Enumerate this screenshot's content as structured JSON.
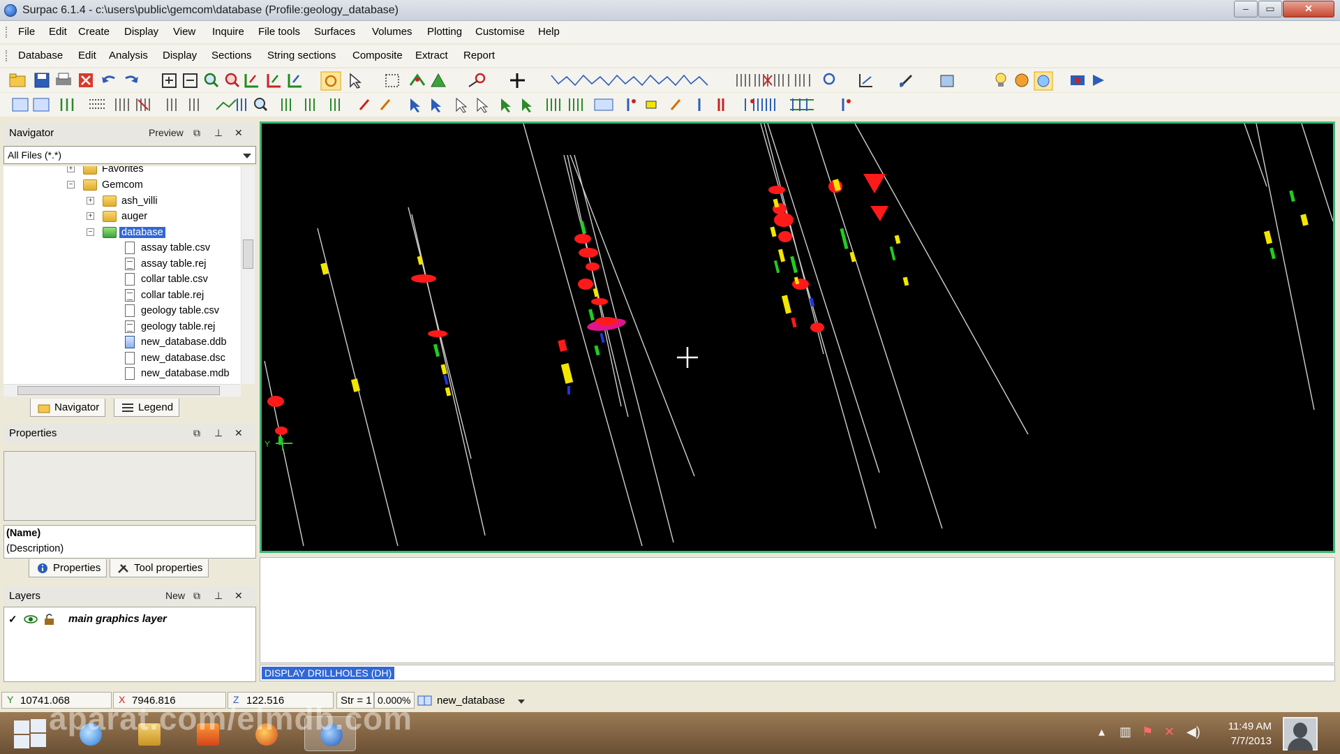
{
  "window": {
    "title": "Surpac 6.1.4 - c:\\users\\public\\gemcom\\database (Profile:geology_database)",
    "min_glyph": "–",
    "max_glyph": "▭",
    "close_glyph": "✕"
  },
  "menubar": [
    "File",
    "Edit",
    "Create",
    "Display",
    "View",
    "Inquire",
    "File tools",
    "Surfaces",
    "Volumes",
    "Plotting",
    "Customise",
    "Help"
  ],
  "menubar2": [
    "Database",
    "Edit",
    "Analysis",
    "Display",
    "Sections",
    "String sections",
    "Composite",
    "Extract",
    "Report"
  ],
  "navigator": {
    "title": "Navigator",
    "preview_label": "Preview",
    "filter": "All Files (*.*)",
    "tree": [
      {
        "label": "Favorites",
        "kind": "folder",
        "level": 1,
        "expander": "+"
      },
      {
        "label": "Gemcom",
        "kind": "folder",
        "level": 1,
        "expander": "−"
      },
      {
        "label": "ash_villi",
        "kind": "folder",
        "level": 2,
        "expander": "+"
      },
      {
        "label": "auger",
        "kind": "folder",
        "level": 2,
        "expander": "+"
      },
      {
        "label": "database",
        "kind": "folder-selected",
        "level": 2,
        "expander": "−"
      },
      {
        "label": "assay table.csv",
        "kind": "file",
        "level": 3
      },
      {
        "label": "assay table.rej",
        "kind": "file-lined",
        "level": 3
      },
      {
        "label": "collar table.csv",
        "kind": "file",
        "level": 3
      },
      {
        "label": "collar table.rej",
        "kind": "file-lined",
        "level": 3
      },
      {
        "label": "geology table.csv",
        "kind": "file",
        "level": 3
      },
      {
        "label": "geology table.rej",
        "kind": "file-lined",
        "level": 3
      },
      {
        "label": "new_database.ddb",
        "kind": "file-db",
        "level": 3
      },
      {
        "label": "new_database.dsc",
        "kind": "file",
        "level": 3
      },
      {
        "label": "new_database.mdb",
        "kind": "file",
        "level": 3
      }
    ],
    "tabs": [
      "Navigator",
      "Legend"
    ]
  },
  "properties": {
    "title": "Properties",
    "name_label": "(Name)",
    "description_label": "(Description)",
    "tabs": [
      "Properties",
      "Tool properties"
    ]
  },
  "layers": {
    "title": "Layers",
    "new_label": "New",
    "items": [
      {
        "check": "✓",
        "name": "main graphics layer"
      }
    ]
  },
  "viewport": {
    "background": "#000000",
    "frame_color": "#3cb878",
    "axis_label": "Y"
  },
  "command_line": {
    "text": "DISPLAY DRILLHOLES (DH)"
  },
  "status": {
    "y_axis": "Y",
    "y_value": "10741.068",
    "x_axis": "X",
    "x_value": "7946.816",
    "z_axis": "Z",
    "z_value": "122.516",
    "str_label": "Str = 1",
    "percent": "0.000%",
    "database": "new_database"
  },
  "taskbar": {
    "watermark": "aparat.com/elmdb.com",
    "time": "11:49 AM",
    "date": "7/7/2013"
  },
  "colors": {
    "selection": "#3168d5",
    "drillhole_trace": "#d0d0d0",
    "interval_red": "#ff1a1a",
    "interval_yellow": "#f2e600",
    "interval_green": "#22cc22",
    "interval_blue": "#2036d8",
    "interval_magenta": "#e0148c"
  }
}
